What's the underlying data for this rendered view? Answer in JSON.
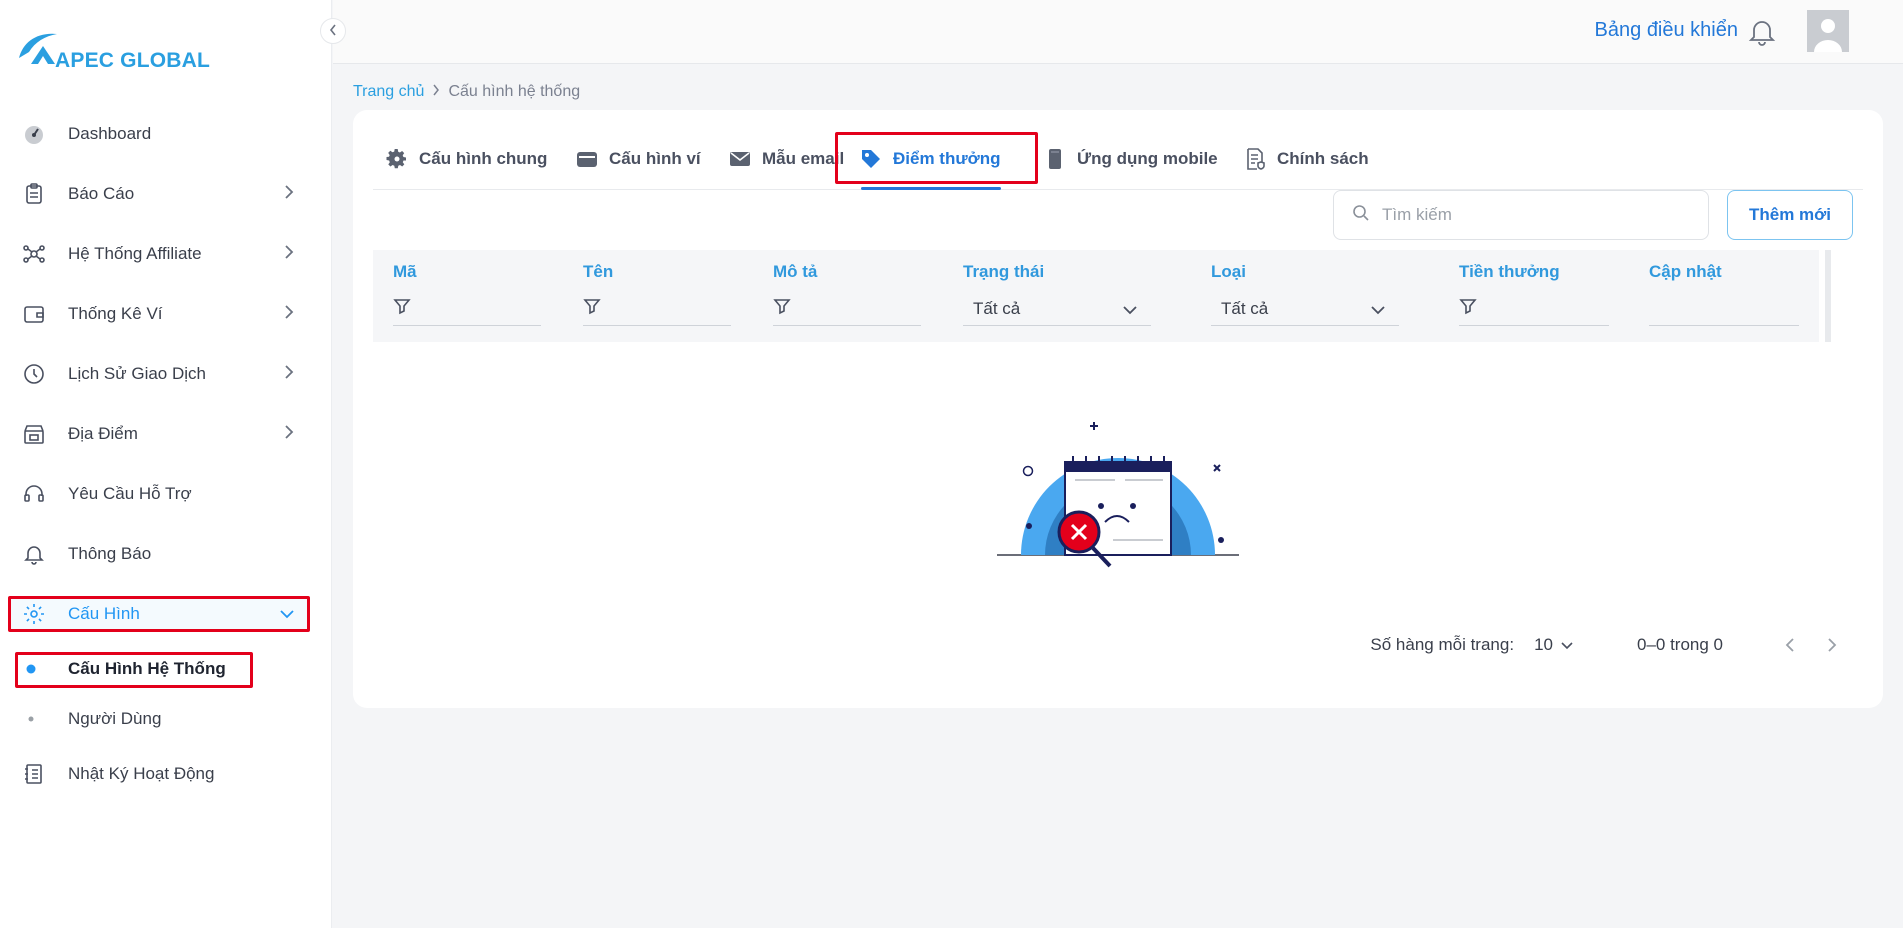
{
  "brand": {
    "name": "APEC GLOBAL",
    "color": "#2a9fe0"
  },
  "header": {
    "dashboard_link": "Bảng điều khiển"
  },
  "sidebar": {
    "items": [
      {
        "label": "Dashboard",
        "icon": "gauge-icon"
      },
      {
        "label": "Báo Cáo",
        "icon": "clipboard-icon"
      },
      {
        "label": "Hệ Thống Affiliate",
        "icon": "network-icon"
      },
      {
        "label": "Thống Kê Ví",
        "icon": "wallet-icon"
      },
      {
        "label": "Lịch Sử Giao Dịch",
        "icon": "clock-icon"
      },
      {
        "label": "Địa Điểm",
        "icon": "store-icon"
      },
      {
        "label": "Yêu Cầu Hỗ Trợ",
        "icon": "headset-icon"
      },
      {
        "label": "Thông Báo",
        "icon": "bell-icon"
      },
      {
        "label": "Cấu Hình",
        "icon": "gear-icon"
      },
      {
        "label": "Nhật Ký Hoạt Động",
        "icon": "notebook-icon"
      }
    ],
    "sub_items": [
      {
        "label": "Cấu Hình Hệ Thống"
      },
      {
        "label": "Người Dùng"
      }
    ]
  },
  "breadcrumb": {
    "home": "Trang chủ",
    "current": "Cấu hình hệ thống"
  },
  "tabs": [
    {
      "label": "Cấu hình chung",
      "icon": "gear-icon"
    },
    {
      "label": "Cấu hình ví",
      "icon": "wallet-icon"
    },
    {
      "label": "Mẫu email",
      "icon": "envelope-icon"
    },
    {
      "label": "Điểm thưởng",
      "icon": "tag-icon"
    },
    {
      "label": "Ứng dụng mobile",
      "icon": "mobile-icon"
    },
    {
      "label": "Chính sách",
      "icon": "policy-doc-icon"
    }
  ],
  "search": {
    "placeholder": "Tìm kiếm",
    "value": ""
  },
  "add_button": "Thêm mới",
  "table": {
    "columns": [
      {
        "title": "Mã"
      },
      {
        "title": "Tên"
      },
      {
        "title": "Mô tả"
      },
      {
        "title": "Trạng thái",
        "select": "Tất cả"
      },
      {
        "title": "Loại",
        "select": "Tất cả"
      },
      {
        "title": "Tiền thưởng"
      },
      {
        "title": "Cập nhật"
      }
    ]
  },
  "pagination": {
    "rows_label": "Số hàng mỗi trang:",
    "rows_per_page": "10",
    "range": "0–0 trong 0"
  },
  "colors": {
    "accent": "#2378d8",
    "highlight": "#e3001b"
  }
}
